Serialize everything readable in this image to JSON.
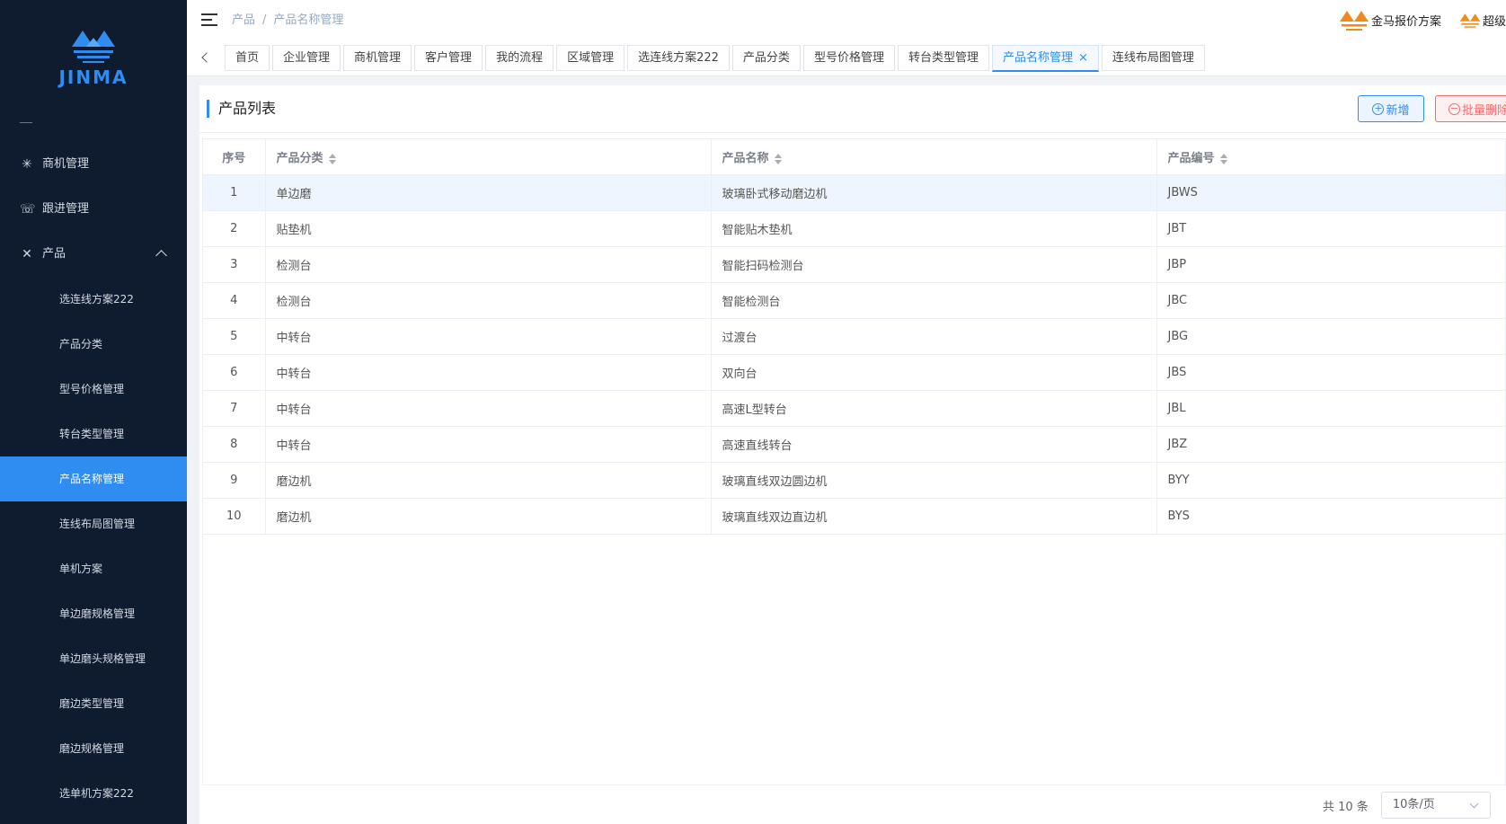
{
  "brand": {
    "logo_text": "JINMA",
    "accent": "#2f8cf0",
    "sidebar_bg": "#0f1c30"
  },
  "sidebar": {
    "items": [
      {
        "label": "商机管理",
        "icon": "snowflake-icon",
        "level": "top"
      },
      {
        "label": "跟进管理",
        "icon": "phone-icon",
        "level": "top"
      },
      {
        "label": "产品",
        "icon": "tools-icon",
        "level": "top",
        "expanded": true
      },
      {
        "label": "选连线方案222",
        "level": "sub"
      },
      {
        "label": "产品分类",
        "level": "sub"
      },
      {
        "label": "型号价格管理",
        "level": "sub"
      },
      {
        "label": "转台类型管理",
        "level": "sub"
      },
      {
        "label": "产品名称管理",
        "level": "sub",
        "active": true
      },
      {
        "label": "连线布局图管理",
        "level": "sub"
      },
      {
        "label": "单机方案",
        "level": "sub"
      },
      {
        "label": "单边磨规格管理",
        "level": "sub"
      },
      {
        "label": "单边磨头规格管理",
        "level": "sub"
      },
      {
        "label": "磨边类型管理",
        "level": "sub"
      },
      {
        "label": "磨边规格管理",
        "level": "sub"
      },
      {
        "label": "选单机方案222",
        "level": "sub"
      }
    ]
  },
  "header": {
    "breadcrumb": [
      "产品",
      "产品名称管理"
    ],
    "right_items": [
      {
        "label": "金马报价方案",
        "icon": "jinma-logo-icon"
      },
      {
        "label": "超级",
        "icon": "jinma-logo-icon"
      }
    ]
  },
  "tags": [
    {
      "label": "首页"
    },
    {
      "label": "企业管理"
    },
    {
      "label": "商机管理"
    },
    {
      "label": "客户管理"
    },
    {
      "label": "我的流程"
    },
    {
      "label": "区域管理"
    },
    {
      "label": "选连线方案222"
    },
    {
      "label": "产品分类"
    },
    {
      "label": "型号价格管理"
    },
    {
      "label": "转台类型管理"
    },
    {
      "label": "产品名称管理",
      "active": true,
      "close": "×"
    },
    {
      "label": "连线布局图管理"
    }
  ],
  "panel": {
    "title": "产品列表",
    "add_label": "新增",
    "batch_delete_label": "批量删除"
  },
  "table": {
    "columns": [
      "序号",
      "产品分类",
      "产品名称",
      "产品编号"
    ],
    "rows": [
      [
        "1",
        "单边磨",
        "玻璃卧式移动磨边机",
        "JBWS"
      ],
      [
        "2",
        "贴垫机",
        "智能贴木垫机",
        "JBT"
      ],
      [
        "3",
        "检测台",
        "智能扫码检测台",
        "JBP"
      ],
      [
        "4",
        "检测台",
        "智能检测台",
        "JBC"
      ],
      [
        "5",
        "中转台",
        "过渡台",
        "JBG"
      ],
      [
        "6",
        "中转台",
        "双向台",
        "JBS"
      ],
      [
        "7",
        "中转台",
        "高速L型转台",
        "JBL"
      ],
      [
        "8",
        "中转台",
        "高速直线转台",
        "JBZ"
      ],
      [
        "9",
        "磨边机",
        "玻璃直线双边圆边机",
        "BYY"
      ],
      [
        "10",
        "磨边机",
        "玻璃直线双边直边机",
        "BYS"
      ]
    ]
  },
  "pager": {
    "total": "共 10 条",
    "page_size": "10条/页"
  }
}
